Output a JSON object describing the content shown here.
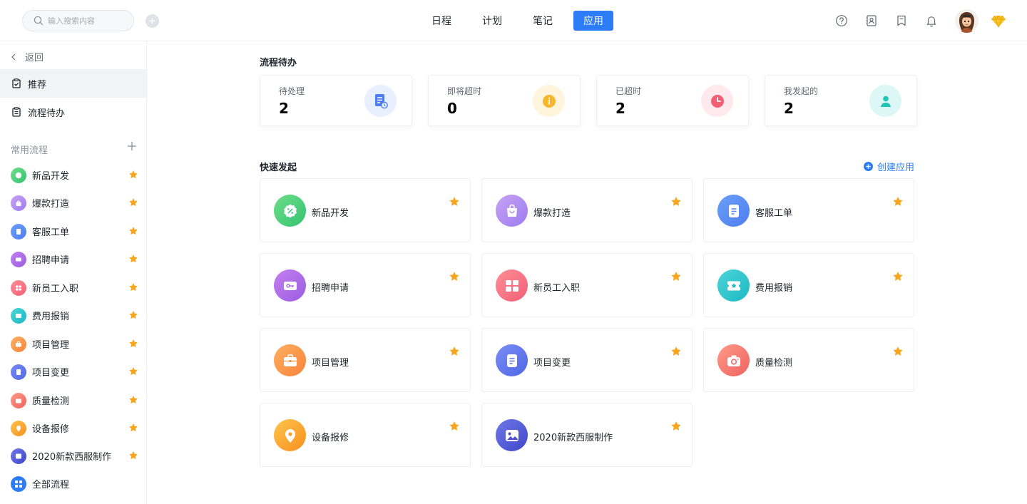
{
  "colors": {
    "primary": "#2b7cf6",
    "star": "#f7a51c",
    "text": "#1f2329",
    "muted": "#8f959e"
  },
  "header": {
    "search_placeholder": "输入搜索内容",
    "tabs": [
      {
        "label": "日程",
        "active": false
      },
      {
        "label": "计划",
        "active": false
      },
      {
        "label": "笔记",
        "active": false
      },
      {
        "label": "应用",
        "active": true
      }
    ],
    "icons": [
      "help-icon",
      "contacts-icon",
      "bookmark-icon",
      "bell-icon",
      "avatar",
      "diamond-icon"
    ]
  },
  "sidebar": {
    "back_label": "返回",
    "nav": [
      {
        "label": "推荐",
        "icon": "clipboard-check-icon",
        "active": true
      },
      {
        "label": "流程待办",
        "icon": "clipboard-list-icon",
        "active": false
      }
    ],
    "section_title": "常用流程",
    "flows": [
      {
        "label": "新品开发",
        "color": "green"
      },
      {
        "label": "爆款打造",
        "color": "purple"
      },
      {
        "label": "客服工单",
        "color": "blue"
      },
      {
        "label": "招聘申请",
        "color": "violet"
      },
      {
        "label": "新员工入职",
        "color": "red"
      },
      {
        "label": "费用报销",
        "color": "cyan"
      },
      {
        "label": "项目管理",
        "color": "orange"
      },
      {
        "label": "项目变更",
        "color": "indigo"
      },
      {
        "label": "质量检测",
        "color": "coral"
      },
      {
        "label": "设备报修",
        "color": "amber"
      },
      {
        "label": "2020新款西服制作",
        "color": "deep"
      }
    ],
    "all_flows_label": "全部流程"
  },
  "main": {
    "todo_title": "流程待办",
    "stats": [
      {
        "label": "待处理",
        "value": "2",
        "icon": "document-clock-icon"
      },
      {
        "label": "即将超时",
        "value": "0",
        "icon": "info-icon"
      },
      {
        "label": "已超时",
        "value": "2",
        "icon": "clock-icon"
      },
      {
        "label": "我发起的",
        "value": "2",
        "icon": "user-icon"
      }
    ],
    "quick_title": "快速发起",
    "create_label": "创建应用",
    "apps": [
      {
        "label": "新品开发",
        "icon": "percent-badge-icon"
      },
      {
        "label": "爆款打造",
        "icon": "shopping-bag-icon"
      },
      {
        "label": "客服工单",
        "icon": "document-icon"
      },
      {
        "label": "招聘申请",
        "icon": "key-card-icon"
      },
      {
        "label": "新员工入职",
        "icon": "ticket-icon"
      },
      {
        "label": "费用报销",
        "icon": "star-ticket-icon"
      },
      {
        "label": "项目管理",
        "icon": "briefcase-icon"
      },
      {
        "label": "项目变更",
        "icon": "document-icon"
      },
      {
        "label": "质量检测",
        "icon": "camera-icon"
      },
      {
        "label": "设备报修",
        "icon": "location-pin-icon"
      },
      {
        "label": "2020新款西服制作",
        "icon": "image-icon"
      }
    ]
  }
}
